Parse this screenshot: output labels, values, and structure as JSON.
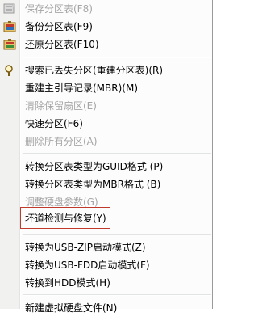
{
  "menu": {
    "items": [
      {
        "label": "保存分区表(F8)",
        "disabled": true,
        "icon": "save-partition-table-icon"
      },
      {
        "label": "备份分区表(F9)",
        "disabled": false,
        "icon": "backup-partition-table-icon"
      },
      {
        "label": "还原分区表(F10)",
        "disabled": false,
        "icon": "restore-partition-table-icon"
      },
      {
        "label": "搜索已丢失分区(重建分区表)(R)",
        "disabled": false,
        "icon": "search-lost-partition-icon"
      },
      {
        "label": "重建主引导记录(MBR)(M)",
        "disabled": false
      },
      {
        "label": "清除保留扇区(E)",
        "disabled": true
      },
      {
        "label": "快速分区(F6)",
        "disabled": false
      },
      {
        "label": "删除所有分区(A)",
        "disabled": true
      },
      {
        "label": "转换分区表类型为GUID格式 (P)",
        "disabled": false
      },
      {
        "label": "转换分区表类型为MBR格式 (B)",
        "disabled": false
      },
      {
        "label": "调整硬盘参数(G)",
        "disabled": true
      },
      {
        "label": "坏道检测与修复(Y)",
        "disabled": false
      },
      {
        "label": "转换为USB-ZIP启动模式(Z)",
        "disabled": false
      },
      {
        "label": "转换为USB-FDD启动模式(F)",
        "disabled": false
      },
      {
        "label": "转换到HDD模式(H)",
        "disabled": false
      },
      {
        "label": "新建虚拟硬盘文件(N)",
        "disabled": false
      }
    ]
  },
  "colors": {
    "highlight_border": "#c0392b",
    "disabled_text": "#a5a5a5"
  }
}
